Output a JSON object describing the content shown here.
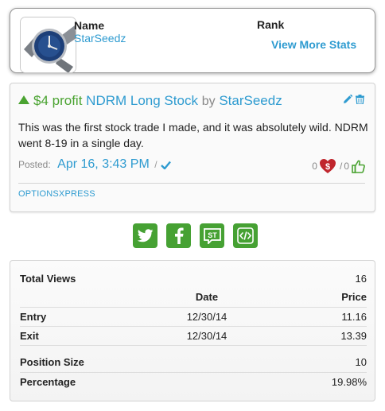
{
  "profile": {
    "name_label": "Name",
    "name_value": "StarSeedz",
    "rank_label": "Rank",
    "view_more_stats": "View More Stats",
    "avatar_icon": "watch-icon"
  },
  "trade": {
    "direction_icon": "triangle-up-icon",
    "profit": "$4 profit",
    "title": "NDRM Long Stock",
    "by": "by",
    "author": "StarSeedz",
    "description": "This was the first stock trade I made, and it was absolutely wild. NDRM went 8-19 in a single day.",
    "posted_label": "Posted:",
    "posted_date": "Apr 16, 3:43 PM",
    "posted_slash": "/",
    "dislikes": "0",
    "separator": "/",
    "likes": "0",
    "broker": "OPTIONSXPRESS",
    "colors": {
      "profit_green": "#4aa331",
      "link_blue": "#2e9bd0",
      "dislike_red": "#c0262d"
    }
  },
  "share": {
    "buttons": [
      {
        "name": "twitter",
        "icon": "twitter-icon"
      },
      {
        "name": "facebook",
        "icon": "facebook-icon"
      },
      {
        "name": "stocktwits",
        "icon": "stocktwits-icon",
        "text": "ST"
      },
      {
        "name": "embed",
        "icon": "code-icon"
      }
    ],
    "color": "#46a133"
  },
  "stats": {
    "total_views_label": "Total Views",
    "total_views_value": "16",
    "columns": {
      "date": "Date",
      "price": "Price"
    },
    "rows": [
      {
        "label": "Entry",
        "date": "12/30/14",
        "price": "11.16"
      },
      {
        "label": "Exit",
        "date": "12/30/14",
        "price": "13.39"
      }
    ],
    "position_size_label": "Position Size",
    "position_size_value": "10",
    "percentage_label": "Percentage",
    "percentage_value": "19.98%"
  }
}
